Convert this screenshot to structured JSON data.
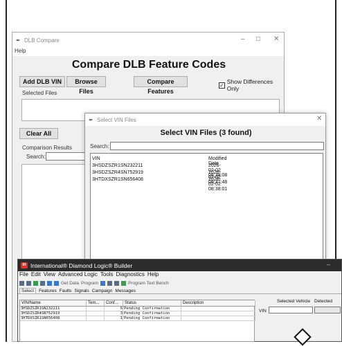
{
  "dlb_compare": {
    "title": "DLB Compare",
    "menu_help": "Help",
    "heading": "Compare DLB Feature Codes",
    "add_vin_label": "Add DLB VIN",
    "browse_label": "Browse Files",
    "compare_label": "Compare Features",
    "show_diff_label": "Show Differences Only",
    "selected_files_label": "Selected Files",
    "clear_all_label": "Clear All",
    "comparison_results_label": "Comparison Results",
    "search_label": "Search:"
  },
  "select_vin": {
    "title": "Select VIN Files",
    "heading": "Select VIN Files (3 found)",
    "search_label": "Search:",
    "columns": [
      "VIN",
      "Modified Date"
    ],
    "rows": [
      {
        "vin": "3HSDZSZR1SN232211",
        "date": "2026-02-02 08:38:08"
      },
      {
        "vin": "3HSDZSZR4SN752919",
        "date": "2026-02-02 08:37:48"
      },
      {
        "vin": "3HTDXSZR1SN656408",
        "date": "2026-02-02 08:38:01"
      }
    ]
  },
  "diamond_logic": {
    "title": "International® Diamond Logic® Builder",
    "menu": [
      "File",
      "Edit",
      "View",
      "Advanced Logic",
      "Tools",
      "Diagnostics",
      "Help"
    ],
    "toolbar": {
      "get_data": "Get Data",
      "program": "Program",
      "program_text_bench": "Program Text Bench"
    },
    "tabs": [
      "Select",
      "Features",
      "Faults",
      "Signals",
      "Campaign",
      "Messages"
    ],
    "columns": [
      "VIN/Name",
      "Tem...",
      "Conf...",
      "Status",
      "Description"
    ],
    "rows": [
      {
        "vin": "3HSDZSZR1SN232211",
        "conf": "6",
        "status": "Pending Confirmation"
      },
      {
        "vin": "3HSDZSZR4SN752919",
        "conf": "3",
        "status": "Pending Confirmation"
      },
      {
        "vin": "3HTDXSZR1SN656408",
        "conf": "1",
        "status": "Pending Confirmation"
      }
    ],
    "selected_vehicle_label": "Selected Vehicle",
    "detected_label": "Detected",
    "vin_label": "VIN"
  }
}
